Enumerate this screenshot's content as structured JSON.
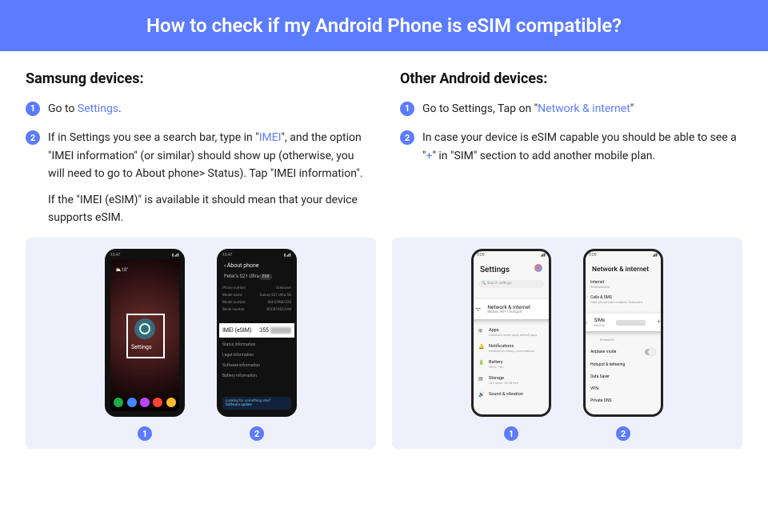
{
  "header": {
    "title": "How to check if my Android Phone is eSIM compatible?"
  },
  "samsung": {
    "title": "Samsung devices:",
    "step1_a": "Go to ",
    "step1_link": "Settings",
    "step1_b": ".",
    "step2_a": "If in Settings you see a search bar, type in \"",
    "step2_link": "IMEI",
    "step2_b": "\", and the option \"IMEI information\" (or similar) should show up (otherwise, you will need to go to About phone> Status). Tap \"IMEI information\".",
    "step2_extra": "If the \"IMEI (eSIM)\" is available it should mean that your device supports eSIM."
  },
  "other": {
    "title": "Other Android devices:",
    "step1_a": "Go to Settings, Tap on \"",
    "step1_link": "Network & internet",
    "step1_b": "\"",
    "step2_a": "In case your device is eSIM capable you should be able to see a \"",
    "step2_link": "+",
    "step2_b": "\" in \"SIM\" section to add another mobile plan."
  },
  "mock": {
    "samsung_home": {
      "weather": "⛅18°",
      "settings_label": "Settings"
    },
    "samsung_about": {
      "header": "‹  About phone",
      "device": "Peter's S21 Ultra",
      "edit": "Edit",
      "rows": [
        {
          "k": "Phone number",
          "v": "Unknown"
        },
        {
          "k": "Model name",
          "v": "Galaxy S21 Ultra 5G"
        },
        {
          "k": "Model number",
          "v": "SM-G998U1DS"
        },
        {
          "k": "Serial number",
          "v": "R5CR10S3JVM"
        }
      ],
      "imei_label": "IMEI (eSIM)",
      "imei_prefix": "355",
      "low": [
        "Status information",
        "Legal information",
        "Software information",
        "Battery information"
      ],
      "footer_t": "Looking for something else?",
      "footer_s": "Software update"
    },
    "android_settings": {
      "title": "Settings",
      "search": "🔍 Search settings",
      "pop_title": "Network & internet",
      "pop_sub": "Mobile, Wi-Fi, hotspot",
      "rows": [
        {
          "t": "Apps",
          "s": "Assistant, recent apps, default apps"
        },
        {
          "t": "Notifications",
          "s": "Notification history, conversations"
        },
        {
          "t": "Battery",
          "s": "100% - Full"
        },
        {
          "t": "Storage",
          "s": "26% used - 94 GB free"
        },
        {
          "t": "Sound & vibration",
          "s": ""
        }
      ]
    },
    "android_net": {
      "title": "Network & internet",
      "top": [
        {
          "t": "Internet",
          "s": "RedteaMobile"
        },
        {
          "t": "Calls & SMS",
          "s": "Data, phone calls enabled, RedteaGO"
        }
      ],
      "pop_label": "SIMs",
      "pop_sub": "RedTea",
      "low_sub": "RedteaGO",
      "low": [
        "Airplane mode",
        "Hotspot & tethering",
        "Data Saver",
        "VPN",
        "Private DNS"
      ]
    }
  },
  "badges": {
    "one": "1",
    "two": "2"
  }
}
